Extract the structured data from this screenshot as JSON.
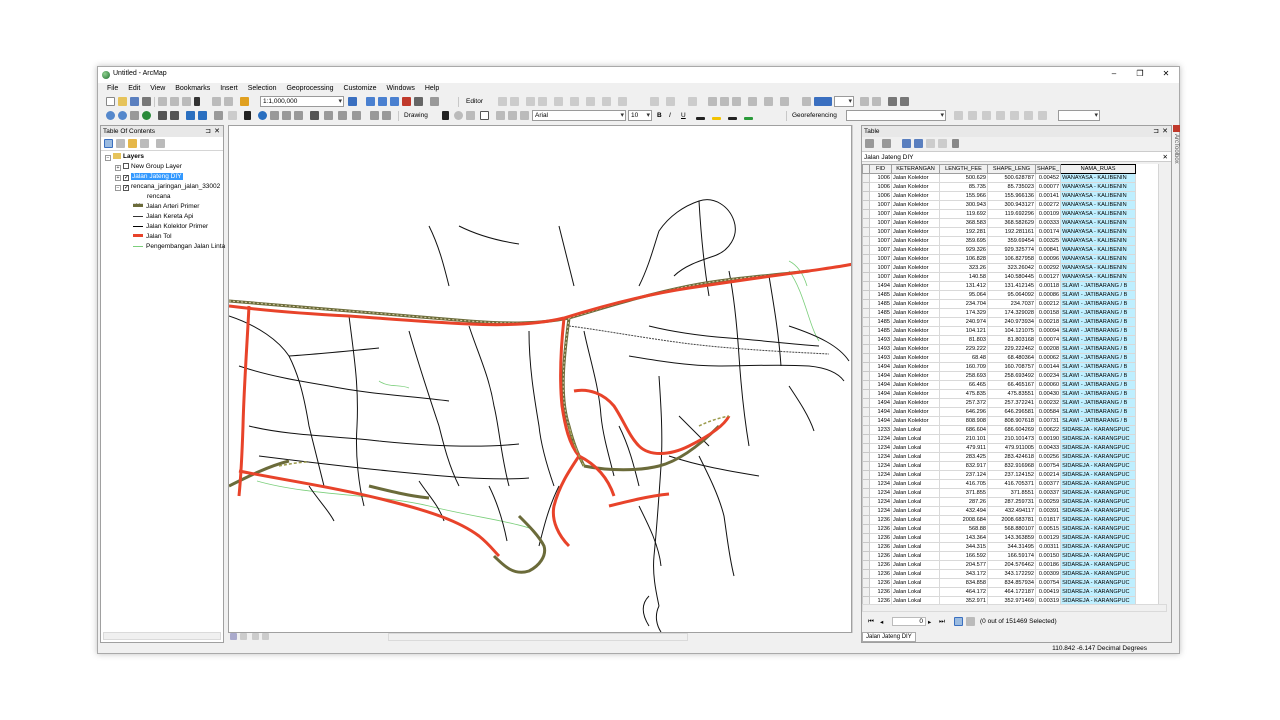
{
  "window": {
    "title": "Untitled - ArcMap",
    "minimize": "–",
    "maximize": "❐",
    "close": "✕"
  },
  "menu": [
    "File",
    "Edit",
    "View",
    "Bookmarks",
    "Insert",
    "Selection",
    "Geoprocessing",
    "Customize",
    "Windows",
    "Help"
  ],
  "toolbar": {
    "scale": "1:1,000,000",
    "editor_label": "Editor",
    "drawing_label": "Drawing",
    "font_name": "Arial",
    "font_size": "10",
    "bold": "B",
    "italic": "I",
    "underline": "U",
    "georeferencing_label": "Georeferencing"
  },
  "toc": {
    "title": "Table Of Contents",
    "root": "Layers",
    "layers": [
      {
        "name": "New Group Layer",
        "checked": false,
        "selected": false
      },
      {
        "name": "Jalan Jateng DIY",
        "checked": true,
        "selected": true
      },
      {
        "name": "rencana_jaringan_jalan_33002",
        "checked": true,
        "selected": false
      }
    ],
    "field_label": "rencana",
    "legend": [
      {
        "label": "Jalan Arteri Primer",
        "color": "#6b6b3a"
      },
      {
        "label": "Jalan Kereta Api",
        "color": "#333333"
      },
      {
        "label": "Jalan Kolektor Primer",
        "color": "#000000"
      },
      {
        "label": "Jalan Tol",
        "color": "#e8432a"
      },
      {
        "label": "Pengembangan Jalan Linta",
        "color": "#7ccf7c"
      }
    ]
  },
  "table": {
    "window_title": "Table",
    "layer_tab": "Jalan Jateng DIY",
    "columns": [
      "FID",
      "KETERANGAN",
      "LENGTH_FEE",
      "SHAPE_LENG",
      "SHAPE_",
      "NAMA_RUAS"
    ],
    "rows": [
      [
        "1006",
        "Jalan Kolektor",
        "500.629",
        "500.628787",
        "0.00452",
        "WANAYASA - KALIBENIN"
      ],
      [
        "1006",
        "Jalan Kolektor",
        "85.735",
        "85.735023",
        "0.00077",
        "WANAYASA - KALIBENIN"
      ],
      [
        "1006",
        "Jalan Kolektor",
        "155.966",
        "155.966136",
        "0.00141",
        "WANAYASA - KALIBENIN"
      ],
      [
        "1007",
        "Jalan Kolektor",
        "300.943",
        "300.943127",
        "0.00272",
        "WANAYASA - KALIBENIN"
      ],
      [
        "1007",
        "Jalan Kolektor",
        "119.692",
        "119.692296",
        "0.00109",
        "WANAYASA - KALIBENIN"
      ],
      [
        "1007",
        "Jalan Kolektor",
        "368.583",
        "368.582629",
        "0.00333",
        "WANAYASA - KALIBENIN"
      ],
      [
        "1007",
        "Jalan Kolektor",
        "192.281",
        "192.281161",
        "0.00174",
        "WANAYASA - KALIBENIN"
      ],
      [
        "1007",
        "Jalan Kolektor",
        "359.695",
        "359.69454",
        "0.00325",
        "WANAYASA - KALIBENIN"
      ],
      [
        "1007",
        "Jalan Kolektor",
        "929.326",
        "929.325774",
        "0.00841",
        "WANAYASA - KALIBENIN"
      ],
      [
        "1007",
        "Jalan Kolektor",
        "106.828",
        "106.827958",
        "0.00096",
        "WANAYASA - KALIBENIN"
      ],
      [
        "1007",
        "Jalan Kolektor",
        "323.26",
        "323.26042",
        "0.00292",
        "WANAYASA - KALIBENIN"
      ],
      [
        "1007",
        "Jalan Kolektor",
        "140.58",
        "140.580445",
        "0.00127",
        "WANAYASA - KALIBENIN"
      ],
      [
        "1494",
        "Jalan Kolektor",
        "131.412",
        "131.412145",
        "0.00118",
        "SLAWI - JATIBARANG / B"
      ],
      [
        "1485",
        "Jalan Kolektor",
        "95.064",
        "95.064092",
        "0.00086",
        "SLAWI - JATIBARANG / B"
      ],
      [
        "1485",
        "Jalan Kolektor",
        "234.704",
        "234.7037",
        "0.00212",
        "SLAWI - JATIBARANG / B"
      ],
      [
        "1485",
        "Jalan Kolektor",
        "174.329",
        "174.329028",
        "0.00158",
        "SLAWI - JATIBARANG / B"
      ],
      [
        "1485",
        "Jalan Kolektor",
        "240.974",
        "240.973934",
        "0.00218",
        "SLAWI - JATIBARANG / B"
      ],
      [
        "1485",
        "Jalan Kolektor",
        "104.121",
        "104.121075",
        "0.00094",
        "SLAWI - JATIBARANG / B"
      ],
      [
        "1493",
        "Jalan Kolektor",
        "81.803",
        "81.803168",
        "0.00074",
        "SLAWI - JATIBARANG / B"
      ],
      [
        "1493",
        "Jalan Kolektor",
        "229.222",
        "229.222462",
        "0.00208",
        "SLAWI - JATIBARANG / B"
      ],
      [
        "1493",
        "Jalan Kolektor",
        "68.48",
        "68.480364",
        "0.00062",
        "SLAWI - JATIBARANG / B"
      ],
      [
        "1494",
        "Jalan Kolektor",
        "160.709",
        "160.708757",
        "0.00144",
        "SLAWI - JATIBARANG / B"
      ],
      [
        "1494",
        "Jalan Kolektor",
        "258.693",
        "258.693492",
        "0.00234",
        "SLAWI - JATIBARANG / B"
      ],
      [
        "1494",
        "Jalan Kolektor",
        "66.465",
        "66.465167",
        "0.00060",
        "SLAWI - JATIBARANG / B"
      ],
      [
        "1494",
        "Jalan Kolektor",
        "475.835",
        "475.83551",
        "0.00430",
        "SLAWI - JATIBARANG / B"
      ],
      [
        "1494",
        "Jalan Kolektor",
        "257.372",
        "257.372241",
        "0.00232",
        "SLAWI - JATIBARANG / B"
      ],
      [
        "1494",
        "Jalan Kolektor",
        "646.296",
        "646.296581",
        "0.00584",
        "SLAWI - JATIBARANG / B"
      ],
      [
        "1494",
        "Jalan Kolektor",
        "808.908",
        "808.907618",
        "0.00731",
        "SLAWI - JATIBARANG / B"
      ],
      [
        "1233",
        "Jalan Lokal",
        "686.604",
        "686.604269",
        "0.00622",
        "SIDAREJA - KARANGPUC"
      ],
      [
        "1234",
        "Jalan Lokal",
        "210.101",
        "210.101473",
        "0.00190",
        "SIDAREJA - KARANGPUC"
      ],
      [
        "1234",
        "Jalan Lokal",
        "479.911",
        "479.911005",
        "0.00433",
        "SIDAREJA - KARANGPUC"
      ],
      [
        "1234",
        "Jalan Lokal",
        "283.425",
        "283.424618",
        "0.00256",
        "SIDAREJA - KARANGPUC"
      ],
      [
        "1234",
        "Jalan Lokal",
        "832.917",
        "832.916968",
        "0.00754",
        "SIDAREJA - KARANGPUC"
      ],
      [
        "1234",
        "Jalan Lokal",
        "237.124",
        "237.124152",
        "0.00214",
        "SIDAREJA - KARANGPUC"
      ],
      [
        "1234",
        "Jalan Lokal",
        "416.705",
        "416.705371",
        "0.00377",
        "SIDAREJA - KARANGPUC"
      ],
      [
        "1234",
        "Jalan Lokal",
        "371.855",
        "371.8551",
        "0.00337",
        "SIDAREJA - KARANGPUC"
      ],
      [
        "1234",
        "Jalan Lokal",
        "287.26",
        "287.259731",
        "0.00259",
        "SIDAREJA - KARANGPUC"
      ],
      [
        "1234",
        "Jalan Lokal",
        "432.494",
        "432.494117",
        "0.00391",
        "SIDAREJA - KARANGPUC"
      ],
      [
        "1236",
        "Jalan Lokal",
        "2008.684",
        "2008.683781",
        "0.01817",
        "SIDAREJA - KARANGPUC"
      ],
      [
        "1236",
        "Jalan Lokal",
        "568.88",
        "568.880107",
        "0.00515",
        "SIDAREJA - KARANGPUC"
      ],
      [
        "1236",
        "Jalan Lokal",
        "143.364",
        "143.363859",
        "0.00129",
        "SIDAREJA - KARANGPUC"
      ],
      [
        "1236",
        "Jalan Lokal",
        "344.315",
        "344.31495",
        "0.00311",
        "SIDAREJA - KARANGPUC"
      ],
      [
        "1236",
        "Jalan Lokal",
        "166.592",
        "166.59174",
        "0.00150",
        "SIDAREJA - KARANGPUC"
      ],
      [
        "1236",
        "Jalan Lokal",
        "204.577",
        "204.576462",
        "0.00186",
        "SIDAREJA - KARANGPUC"
      ],
      [
        "1236",
        "Jalan Lokal",
        "343.172",
        "343.172292",
        "0.00309",
        "SIDAREJA - KARANGPUC"
      ],
      [
        "1236",
        "Jalan Lokal",
        "834.858",
        "834.857934",
        "0.00754",
        "SIDAREJA - KARANGPUC"
      ],
      [
        "1236",
        "Jalan Lokal",
        "464.172",
        "464.172187",
        "0.00419",
        "SIDAREJA - KARANGPUC"
      ],
      [
        "1236",
        "Jalan Lokal",
        "352.971",
        "352.971469",
        "0.00319",
        "SIDAREJA - KARANGPUC"
      ]
    ],
    "record_value": "0",
    "selection_text": "(0 out of 151469 Selected)",
    "bottom_tab": "Jalan Jateng DIY",
    "arctoolbox_label": "ArcToolbox"
  },
  "status": {
    "coords": "110.842  -6.147 Decimal Degrees"
  },
  "colors": {
    "toll": "#e8432a",
    "arterial": "#6b6b3a",
    "collector": "#000000",
    "development": "#7ccf7c",
    "selection": "#3399ff",
    "highlight": "#bfefff"
  }
}
